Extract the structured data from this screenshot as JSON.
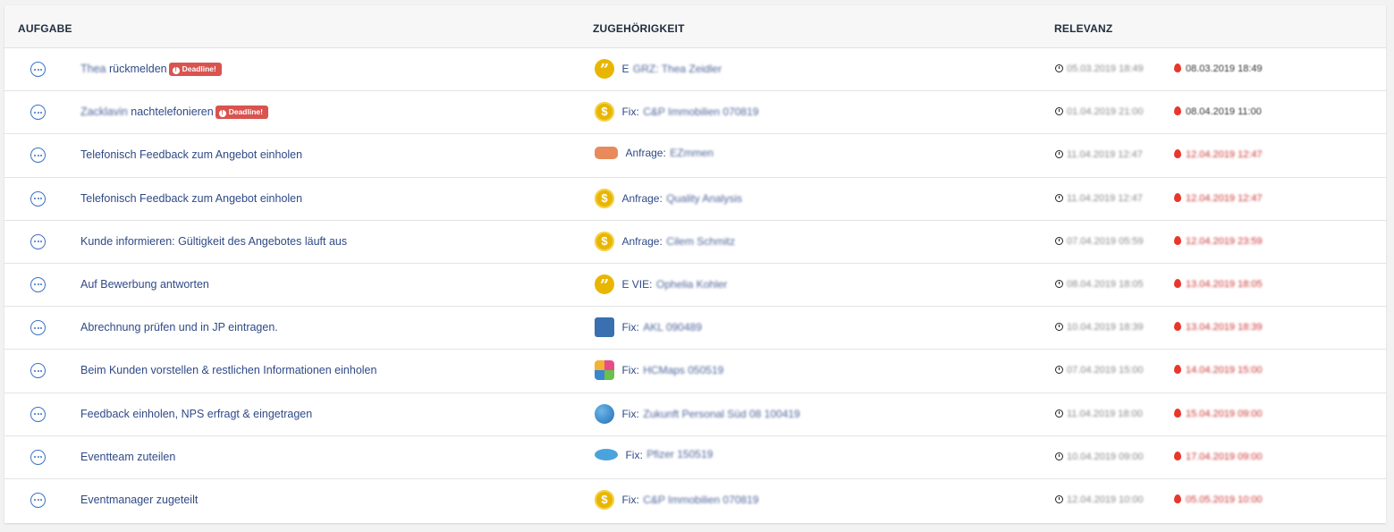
{
  "header": {
    "task_label": "AUFGABE",
    "association_label": "ZUGEHÖRIGKEIT",
    "relevance_label": "RELEVANZ"
  },
  "deadline_badge": "Deadline!",
  "rows": [
    {
      "task_prefix": "Thea",
      "task": "rückmelden",
      "deadline": true,
      "assoc_icon": "quote-icon",
      "assoc_label": "E",
      "assoc_value": "GRZ: Thea Zeidler",
      "created": "05.03.2019 18:49",
      "due": "08.03.2019 18:49",
      "due_dark": true
    },
    {
      "task_prefix": "Zacklavin",
      "task": "nachtelefonieren",
      "deadline": true,
      "assoc_icon": "coin-icon",
      "assoc_label": "Fix:",
      "assoc_value": "C&P Immobilien 070819",
      "created": "01.04.2019 21:00",
      "due": "08.04.2019 11:00",
      "due_dark": true
    },
    {
      "task_prefix": "",
      "task": "Telefonisch Feedback zum Angebot einholen",
      "deadline": false,
      "assoc_icon": "company-logo-orange-icon",
      "assoc_label": "Anfrage:",
      "assoc_value": "EZmmen",
      "created": "11.04.2019 12:47",
      "due": "12.04.2019 12:47",
      "due_dark": false
    },
    {
      "task_prefix": "",
      "task": "Telefonisch Feedback zum Angebot einholen",
      "deadline": false,
      "assoc_icon": "coin-icon",
      "assoc_label": "Anfrage:",
      "assoc_value": "Quality Analysis",
      "created": "11.04.2019 12:47",
      "due": "12.04.2019 12:47",
      "due_dark": false
    },
    {
      "task_prefix": "",
      "task": "Kunde informieren: Gültigkeit des Angebotes läuft aus",
      "deadline": false,
      "assoc_icon": "coin-icon",
      "assoc_label": "Anfrage:",
      "assoc_value": "Cilem Schmitz",
      "created": "07.04.2019 05:59",
      "due": "12.04.2019 23:59",
      "due_dark": false
    },
    {
      "task_prefix": "",
      "task": "Auf Bewerbung antworten",
      "deadline": false,
      "assoc_icon": "quote-icon",
      "assoc_label": "E VIE:",
      "assoc_value": "Ophelia Kohler",
      "created": "08.04.2019 18:05",
      "due": "13.04.2019 18:05",
      "due_dark": false
    },
    {
      "task_prefix": "",
      "task": "Abrechnung prüfen und in JP eintragen.",
      "deadline": false,
      "assoc_icon": "company-logo-blue-icon",
      "assoc_label": "Fix:",
      "assoc_value": "AKL 090489",
      "created": "10.04.2019 18:39",
      "due": "13.04.2019 18:39",
      "due_dark": false
    },
    {
      "task_prefix": "",
      "task": "Beim Kunden vorstellen & restlichen Informationen einholen",
      "deadline": false,
      "assoc_icon": "company-logo-multicolor-icon",
      "assoc_label": "Fix:",
      "assoc_value": "HCMaps 050519",
      "created": "07.04.2019 15:00",
      "due": "14.04.2019 15:00",
      "due_dark": false
    },
    {
      "task_prefix": "",
      "task": "Feedback einholen, NPS erfragt & eingetragen",
      "deadline": false,
      "assoc_icon": "company-logo-globe-icon",
      "assoc_label": "Fix:",
      "assoc_value": "Zukunft Personal Süd 08 100419",
      "created": "11.04.2019 18:00",
      "due": "15.04.2019 09:00",
      "due_dark": false
    },
    {
      "task_prefix": "",
      "task": "Eventteam zuteilen",
      "deadline": false,
      "assoc_icon": "company-logo-pfizer-icon",
      "assoc_label": "Fix:",
      "assoc_value": "Pfizer 150519",
      "created": "10.04.2019 09:00",
      "due": "17.04.2019 09:00",
      "due_dark": false
    },
    {
      "task_prefix": "",
      "task": "Eventmanager zugeteilt",
      "deadline": false,
      "assoc_icon": "coin-icon",
      "assoc_label": "Fix:",
      "assoc_value": "C&P Immobilien 070819",
      "created": "12.04.2019 10:00",
      "due": "05.05.2019 10:00",
      "due_dark": false
    }
  ],
  "colors": {
    "link": "#2f4a87",
    "badge": "#d9534f",
    "accent": "#3a72c4",
    "due": "#cc3333"
  }
}
